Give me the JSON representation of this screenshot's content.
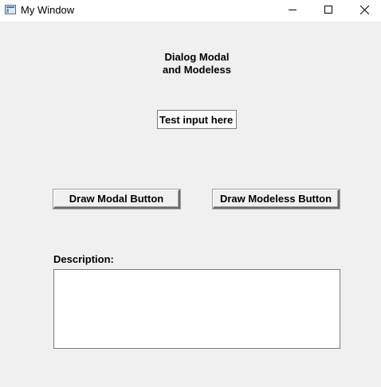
{
  "window": {
    "title": "My Window"
  },
  "heading": {
    "line1": "Dialog Modal",
    "line2": "and Modeless"
  },
  "test_input": {
    "value": "Test input here"
  },
  "buttons": {
    "modal_label": "Draw Modal Button",
    "modeless_label": "Draw Modeless Button"
  },
  "description": {
    "label": "Description:",
    "value": ""
  }
}
